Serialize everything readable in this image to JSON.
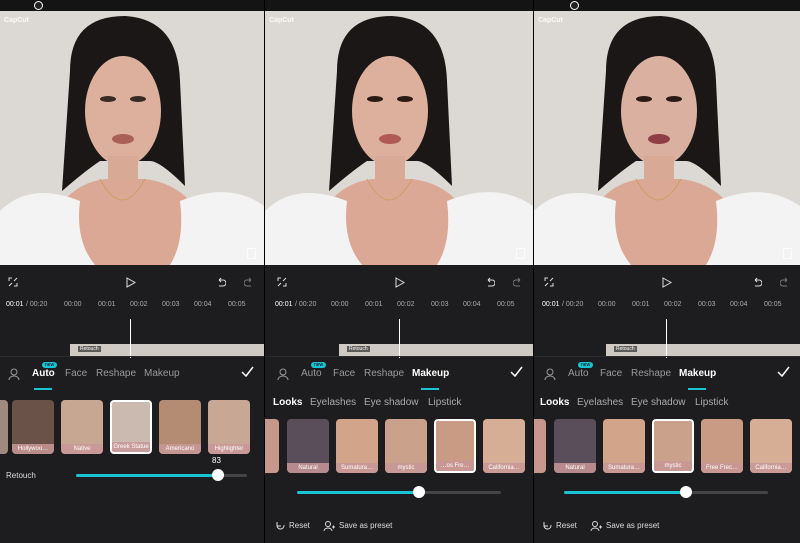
{
  "brand": "CapCut",
  "timeline": {
    "current": "00:01",
    "total": "/ 00:20",
    "ticks": [
      "00:00",
      "00:01",
      "00:02",
      "00:03",
      "00:04",
      "00:05"
    ],
    "track_label": "Retouch"
  },
  "panel1": {
    "tabs": [
      "Auto",
      "Face",
      "Reshape",
      "Makeup"
    ],
    "active_tab": "Auto",
    "new_badge": "new",
    "presets": [
      "Hollywoo…",
      "Native",
      "Greek Statue",
      "Americano",
      "Highlighter"
    ],
    "selected_preset": "Greek Statue",
    "slider_label": "Retouch",
    "slider_value": "83",
    "slider_fraction": 0.83
  },
  "panel2": {
    "tabs": [
      "Auto",
      "Face",
      "Reshape",
      "Makeup"
    ],
    "active_tab": "Makeup",
    "new_badge": "new",
    "subtabs": [
      "Looks",
      "Eyelashes",
      "Eye shadow",
      "Lipstick"
    ],
    "active_subtab": "Looks",
    "presets": [
      "Natural",
      "Sumatura…",
      "mystic",
      "…os Fre…",
      "California…"
    ],
    "selected_preset": "…os Fre…",
    "slider_fraction": 0.6,
    "reset_label": "Reset",
    "save_preset_label": "Save as preset"
  },
  "panel3": {
    "tabs": [
      "Auto",
      "Face",
      "Reshape",
      "Makeup"
    ],
    "active_tab": "Makeup",
    "new_badge": "new",
    "subtabs": [
      "Looks",
      "Eyelashes",
      "Eye shadow",
      "Lipstick"
    ],
    "active_subtab": "Looks",
    "presets": [
      "Natural",
      "Sumatura…",
      "mystic",
      "Free Frec…",
      "California…"
    ],
    "selected_preset": "mystic",
    "slider_fraction": 0.6,
    "reset_label": "Reset",
    "save_preset_label": "Save as preset"
  },
  "colors": {
    "accent": "#19c3d3",
    "panel_bg": "#1d1d1f"
  },
  "icons": [
    "pen-icon",
    "fullscreen-icon",
    "play-icon",
    "undo-icon",
    "redo-icon",
    "person-icon",
    "check-icon",
    "reset-icon",
    "save-preset-icon"
  ]
}
